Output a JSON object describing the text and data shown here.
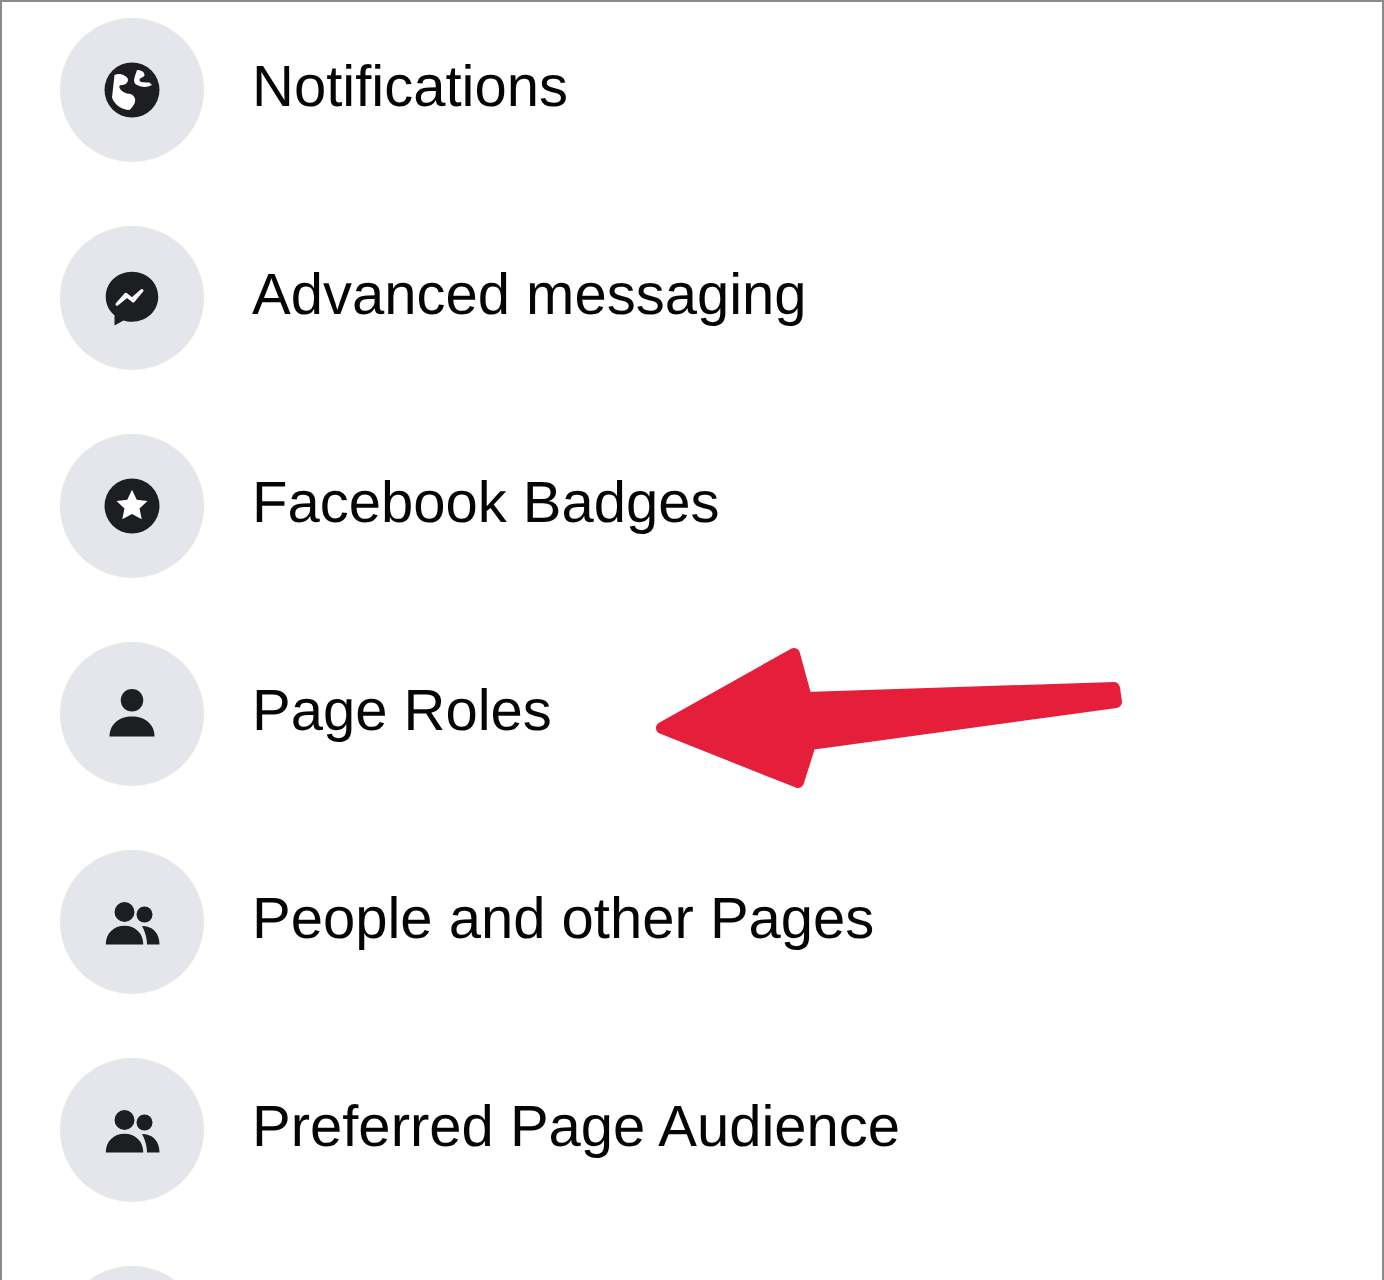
{
  "menu_items": [
    {
      "label": "Notifications"
    },
    {
      "label": "Advanced messaging"
    },
    {
      "label": "Facebook Badges"
    },
    {
      "label": "Page Roles"
    },
    {
      "label": "People and other Pages"
    },
    {
      "label": "Preferred Page Audience"
    }
  ]
}
